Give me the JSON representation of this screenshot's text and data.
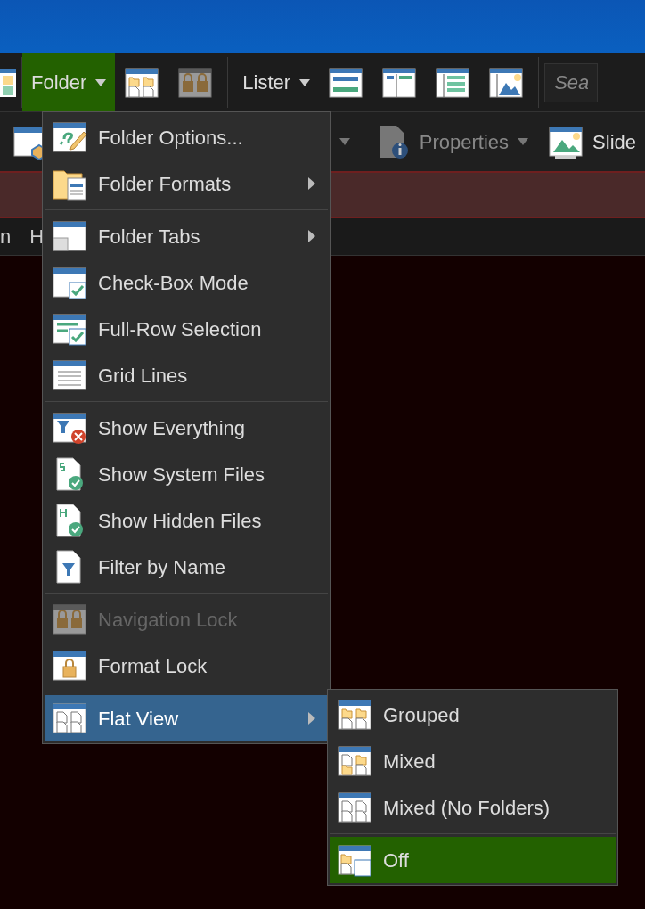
{
  "toolbar": {
    "folder_button": {
      "label": "Folder",
      "selected": true
    },
    "lister_button": {
      "label": "Lister"
    },
    "search": {
      "placeholder": "Sea"
    }
  },
  "toolbar2": {
    "properties": {
      "label": "Properties",
      "disabled": true
    },
    "slides": {
      "label": "Slide"
    }
  },
  "tabs": [
    {
      "label": "n"
    },
    {
      "label": "H"
    }
  ],
  "menu": {
    "groups": [
      [
        {
          "label": "Folder Options...",
          "submenu": false,
          "disabled": false,
          "selected": false
        },
        {
          "label": "Folder Formats",
          "submenu": true,
          "disabled": false,
          "selected": false
        }
      ],
      [
        {
          "label": "Folder Tabs",
          "submenu": true,
          "disabled": false,
          "selected": false
        },
        {
          "label": "Check-Box Mode",
          "submenu": false,
          "disabled": false,
          "selected": false
        },
        {
          "label": "Full-Row Selection",
          "submenu": false,
          "disabled": false,
          "selected": false
        },
        {
          "label": "Grid Lines",
          "submenu": false,
          "disabled": false,
          "selected": false
        }
      ],
      [
        {
          "label": "Show Everything",
          "submenu": false,
          "disabled": false,
          "selected": false
        },
        {
          "label": "Show System Files",
          "submenu": false,
          "disabled": false,
          "selected": false
        },
        {
          "label": "Show Hidden Files",
          "submenu": false,
          "disabled": false,
          "selected": false
        },
        {
          "label": "Filter by Name",
          "submenu": false,
          "disabled": false,
          "selected": false
        }
      ],
      [
        {
          "label": "Navigation Lock",
          "submenu": false,
          "disabled": true,
          "selected": false
        },
        {
          "label": "Format Lock",
          "submenu": false,
          "disabled": false,
          "selected": false
        }
      ],
      [
        {
          "label": "Flat View",
          "submenu": true,
          "disabled": false,
          "selected": true
        }
      ]
    ]
  },
  "submenu": {
    "groups": [
      [
        {
          "label": "Grouped",
          "selected": false
        },
        {
          "label": "Mixed",
          "selected": false
        },
        {
          "label": "Mixed (No Folders)",
          "selected": false
        }
      ],
      [
        {
          "label": "Off",
          "selected": true
        }
      ]
    ]
  }
}
